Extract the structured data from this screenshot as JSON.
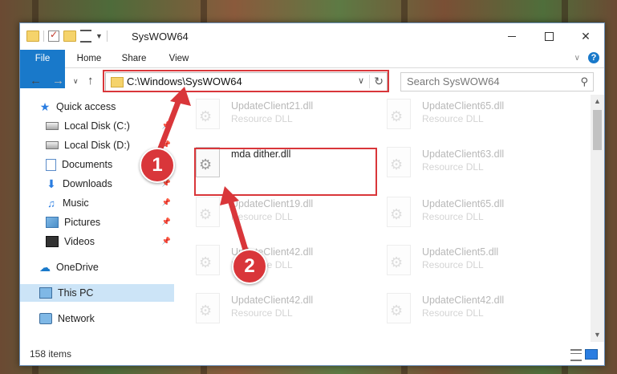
{
  "window": {
    "title": "SysWOW64"
  },
  "ribbon": {
    "tabs": [
      "File",
      "Home",
      "Share",
      "View"
    ]
  },
  "nav": {
    "address": "C:\\Windows\\SysWOW64",
    "search_placeholder": "Search SysWOW64"
  },
  "sidebar": {
    "items": [
      {
        "label": "Quick access",
        "icon": "star-icon"
      },
      {
        "label": "Local Disk (C:)",
        "icon": "disk-icon",
        "pinned": true
      },
      {
        "label": "Local Disk (D:)",
        "icon": "disk-icon",
        "pinned": true
      },
      {
        "label": "Documents",
        "icon": "documents-icon",
        "pinned": true
      },
      {
        "label": "Downloads",
        "icon": "downloads-icon",
        "pinned": true
      },
      {
        "label": "Music",
        "icon": "music-icon",
        "pinned": true
      },
      {
        "label": "Pictures",
        "icon": "pictures-icon",
        "pinned": true
      },
      {
        "label": "Videos",
        "icon": "videos-icon",
        "pinned": true
      },
      {
        "label": "OneDrive",
        "icon": "cloud-icon"
      },
      {
        "label": "This PC",
        "icon": "computer-icon",
        "selected": true
      },
      {
        "label": "Network",
        "icon": "network-icon"
      }
    ]
  },
  "files": {
    "left_column": [
      {
        "name": "UpdateClient21.dll",
        "type": "Resource DLL"
      },
      {
        "name": "mda dither.dll",
        "type": ""
      },
      {
        "name": "UpdateClient19.dll",
        "type": "Resource DLL"
      },
      {
        "name": "UpdateClient42.dll",
        "type": "Resource DLL"
      },
      {
        "name": "UpdateClient42.dll",
        "type": "Resource DLL"
      }
    ],
    "right_column": [
      {
        "name": "UpdateClient65.dll",
        "type": "Resource DLL"
      },
      {
        "name": "UpdateClient63.dll",
        "type": "Resource DLL"
      },
      {
        "name": "UpdateClient65.dll",
        "type": "Resource DLL"
      },
      {
        "name": "UpdateClient5.dll",
        "type": "Resource DLL"
      },
      {
        "name": "UpdateClient42.dll",
        "type": "Resource DLL"
      }
    ]
  },
  "status": {
    "item_count": "158 items"
  },
  "callouts": [
    "1",
    "2"
  ],
  "colors": {
    "accent": "#1979ca",
    "highlight": "#d9363a",
    "selected": "#cce4f7"
  }
}
